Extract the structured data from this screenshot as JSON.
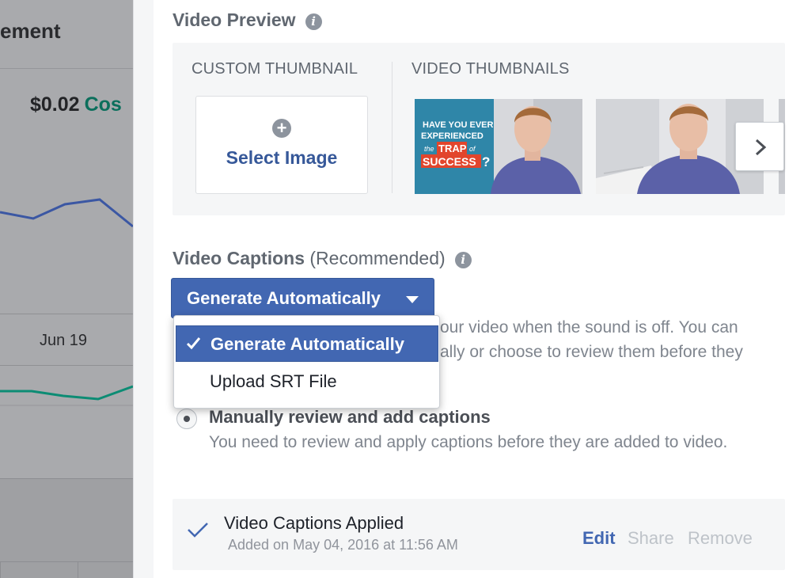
{
  "background": {
    "title_fragment": "ement",
    "cost_value": "$0.02",
    "cost_label_fragment": "Cos",
    "date_label": "Jun 19",
    "colors": {
      "line_blue": "#3b57a3",
      "line_green": "#0c8c74"
    }
  },
  "video_preview": {
    "title": "Video Preview",
    "info_icon": "info-icon",
    "custom_thumbnail_heading": "CUSTOM THUMBNAIL",
    "video_thumbnails_heading": "VIDEO THUMBNAILS",
    "select_image_label": "Select Image",
    "thumbnail_1": {
      "line1": "HAVE YOU EVER",
      "line2": "EXPERIENCED",
      "word_the": "the",
      "word_trap": "TRAP",
      "word_of": "of",
      "word_success": "SUCCESS",
      "mark": "?"
    },
    "next_icon": "chevron-right-icon"
  },
  "video_captions": {
    "title": "Video Captions",
    "subtitle": "(Recommended)",
    "info_icon": "info-icon",
    "button_label": "Generate Automatically",
    "dropdown": {
      "options": [
        "Generate Automatically",
        "Upload SRT File"
      ],
      "selected": "Generate Automatically"
    },
    "hidden_text_line1": "our video when the sound is off. You can",
    "hidden_text_line2": "ally or choose to review them before they",
    "manual_option": {
      "title": "Manually review and add captions",
      "description": "You need to review and apply captions before they are added to video."
    },
    "applied": {
      "title": "Video Captions Applied",
      "date": "Added on May 04, 2016 at 11:56 AM",
      "edit_label": "Edit",
      "share_label": "Share",
      "remove_label": "Remove"
    }
  },
  "colors": {
    "accent": "#4267b2",
    "link": "#365899",
    "muted": "#bec3c9",
    "heading": "#606770"
  }
}
